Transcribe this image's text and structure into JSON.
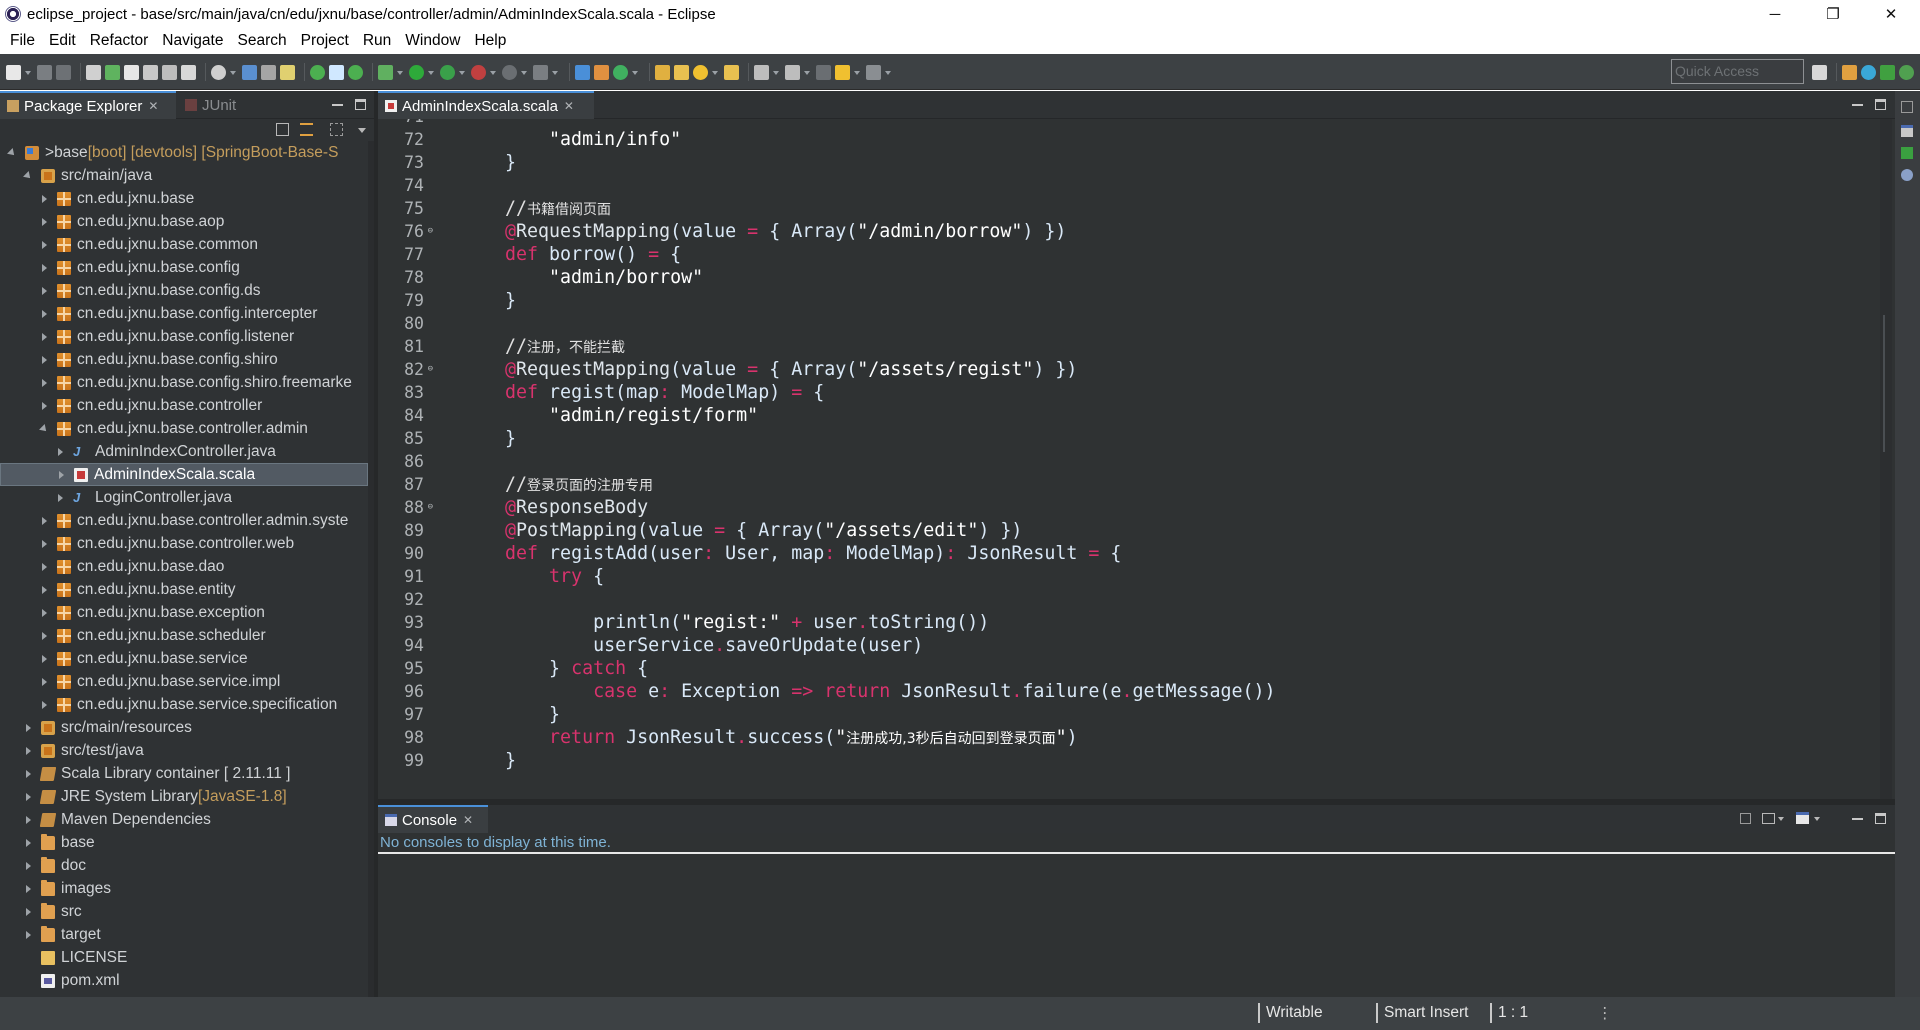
{
  "window": {
    "title": "eclipse_project - base/src/main/java/cn/edu/jxnu/base/controller/admin/AdminIndexScala.scala - Eclipse",
    "minimize": "─",
    "restore": "❐",
    "close": "✕"
  },
  "menu": [
    "File",
    "Edit",
    "Refactor",
    "Navigate",
    "Search",
    "Project",
    "Run",
    "Window",
    "Help"
  ],
  "quick_access": {
    "placeholder": "Quick Access"
  },
  "package_explorer": {
    "tab_label": "Package Explorer",
    "junit_tab_label": "JUnit",
    "tree": [
      {
        "level": 0,
        "twisty": "expanded",
        "icon": "project",
        "prefix": "> ",
        "label": "base",
        "decoration": " [boot] [devtools] [SpringBoot-Base-S"
      },
      {
        "level": 1,
        "twisty": "expanded",
        "icon": "srcfolder",
        "label": "src/main/java"
      },
      {
        "level": 2,
        "twisty": "collapsed",
        "icon": "pkg",
        "label": "cn.edu.jxnu.base"
      },
      {
        "level": 2,
        "twisty": "collapsed",
        "icon": "pkg",
        "label": "cn.edu.jxnu.base.aop"
      },
      {
        "level": 2,
        "twisty": "collapsed",
        "icon": "pkg",
        "label": "cn.edu.jxnu.base.common"
      },
      {
        "level": 2,
        "twisty": "collapsed",
        "icon": "pkg",
        "label": "cn.edu.jxnu.base.config"
      },
      {
        "level": 2,
        "twisty": "collapsed",
        "icon": "pkg",
        "label": "cn.edu.jxnu.base.config.ds"
      },
      {
        "level": 2,
        "twisty": "collapsed",
        "icon": "pkg",
        "label": "cn.edu.jxnu.base.config.intercepter"
      },
      {
        "level": 2,
        "twisty": "collapsed",
        "icon": "pkg",
        "label": "cn.edu.jxnu.base.config.listener"
      },
      {
        "level": 2,
        "twisty": "collapsed",
        "icon": "pkg",
        "label": "cn.edu.jxnu.base.config.shiro"
      },
      {
        "level": 2,
        "twisty": "collapsed",
        "icon": "pkg",
        "label": "cn.edu.jxnu.base.config.shiro.freemarke"
      },
      {
        "level": 2,
        "twisty": "collapsed",
        "icon": "pkg",
        "label": "cn.edu.jxnu.base.controller"
      },
      {
        "level": 2,
        "twisty": "expanded",
        "icon": "pkg",
        "label": "cn.edu.jxnu.base.controller.admin"
      },
      {
        "level": 3,
        "twisty": "collapsed",
        "icon": "java",
        "label": "AdminIndexController.java"
      },
      {
        "level": 3,
        "twisty": "collapsed",
        "icon": "scala",
        "label": "AdminIndexScala.scala",
        "selected": true
      },
      {
        "level": 3,
        "twisty": "collapsed",
        "icon": "java",
        "label": "LoginController.java"
      },
      {
        "level": 2,
        "twisty": "collapsed",
        "icon": "pkg",
        "label": "cn.edu.jxnu.base.controller.admin.syste"
      },
      {
        "level": 2,
        "twisty": "collapsed",
        "icon": "pkg",
        "label": "cn.edu.jxnu.base.controller.web"
      },
      {
        "level": 2,
        "twisty": "collapsed",
        "icon": "pkg",
        "label": "cn.edu.jxnu.base.dao"
      },
      {
        "level": 2,
        "twisty": "collapsed",
        "icon": "pkg",
        "label": "cn.edu.jxnu.base.entity"
      },
      {
        "level": 2,
        "twisty": "collapsed",
        "icon": "pkg",
        "label": "cn.edu.jxnu.base.exception"
      },
      {
        "level": 2,
        "twisty": "collapsed",
        "icon": "pkg",
        "label": "cn.edu.jxnu.base.scheduler"
      },
      {
        "level": 2,
        "twisty": "collapsed",
        "icon": "pkg",
        "label": "cn.edu.jxnu.base.service"
      },
      {
        "level": 2,
        "twisty": "collapsed",
        "icon": "pkg",
        "label": "cn.edu.jxnu.base.service.impl"
      },
      {
        "level": 2,
        "twisty": "collapsed",
        "icon": "pkg",
        "label": "cn.edu.jxnu.base.service.specification"
      },
      {
        "level": 1,
        "twisty": "collapsed",
        "icon": "srcfolder",
        "label": "src/main/resources"
      },
      {
        "level": 1,
        "twisty": "collapsed",
        "icon": "srcfolder",
        "label": "src/test/java"
      },
      {
        "level": 1,
        "twisty": "collapsed",
        "icon": "jar",
        "label": "Scala Library container [ 2.11.11 ]"
      },
      {
        "level": 1,
        "twisty": "collapsed",
        "icon": "jar",
        "label": "JRE System Library",
        "decoration": " [JavaSE-1.8]"
      },
      {
        "level": 1,
        "twisty": "collapsed",
        "icon": "jar",
        "label": "Maven Dependencies"
      },
      {
        "level": 1,
        "twisty": "collapsed",
        "icon": "folder",
        "label": "base"
      },
      {
        "level": 1,
        "twisty": "collapsed",
        "icon": "folder",
        "label": "doc"
      },
      {
        "level": 1,
        "twisty": "collapsed",
        "icon": "folder",
        "label": "images"
      },
      {
        "level": 1,
        "twisty": "collapsed",
        "icon": "folder",
        "label": "src"
      },
      {
        "level": 1,
        "twisty": "collapsed",
        "icon": "folder",
        "label": "target"
      },
      {
        "level": 1,
        "twisty": "none",
        "icon": "file",
        "label": "LICENSE"
      },
      {
        "level": 1,
        "twisty": "none",
        "icon": "xml",
        "label": "pom.xml"
      }
    ]
  },
  "editor": {
    "tab_label": "AdminIndexScala.scala",
    "partial_top_line_number": "71",
    "lines": [
      {
        "n": "72",
        "fold": false,
        "tokens": [
          [
            "str",
            "        \"admin/info\""
          ]
        ]
      },
      {
        "n": "73",
        "fold": false,
        "tokens": [
          [
            "id",
            "    }"
          ]
        ]
      },
      {
        "n": "74",
        "fold": false,
        "tokens": []
      },
      {
        "n": "75",
        "fold": false,
        "tokens": [
          [
            "cmt",
            "    //"
          ],
          [
            "cmtcjk",
            "书籍借阅页面"
          ]
        ]
      },
      {
        "n": "76",
        "fold": true,
        "tokens": [
          [
            "ann",
            "    @"
          ],
          [
            "fn",
            "RequestMapping"
          ],
          [
            "id",
            "(value "
          ],
          [
            "op",
            "="
          ],
          [
            "id",
            " { Array("
          ],
          [
            "str",
            "\"/admin/borrow\""
          ],
          [
            "id",
            ") })"
          ]
        ]
      },
      {
        "n": "77",
        "fold": false,
        "tokens": [
          [
            "kw",
            "    def"
          ],
          [
            "id",
            " borrow() "
          ],
          [
            "op",
            "="
          ],
          [
            "id",
            " {"
          ]
        ]
      },
      {
        "n": "78",
        "fold": false,
        "tokens": [
          [
            "str",
            "        \"admin/borrow\""
          ]
        ]
      },
      {
        "n": "79",
        "fold": false,
        "tokens": [
          [
            "id",
            "    }"
          ]
        ]
      },
      {
        "n": "80",
        "fold": false,
        "tokens": []
      },
      {
        "n": "81",
        "fold": false,
        "tokens": [
          [
            "cmt",
            "    //"
          ],
          [
            "cmtcjk",
            "注册，不能拦截"
          ]
        ]
      },
      {
        "n": "82",
        "fold": true,
        "tokens": [
          [
            "ann",
            "    @"
          ],
          [
            "fn",
            "RequestMapping"
          ],
          [
            "id",
            "(value "
          ],
          [
            "op",
            "="
          ],
          [
            "id",
            " { Array("
          ],
          [
            "str",
            "\"/assets/regist\""
          ],
          [
            "id",
            ") })"
          ]
        ]
      },
      {
        "n": "83",
        "fold": false,
        "tokens": [
          [
            "kw",
            "    def"
          ],
          [
            "id",
            " regist(map"
          ],
          [
            "op",
            ":"
          ],
          [
            "id",
            " ModelMap) "
          ],
          [
            "op",
            "="
          ],
          [
            "id",
            " {"
          ]
        ]
      },
      {
        "n": "84",
        "fold": false,
        "tokens": [
          [
            "str",
            "        \"admin/regist/form\""
          ]
        ]
      },
      {
        "n": "85",
        "fold": false,
        "tokens": [
          [
            "id",
            "    }"
          ]
        ]
      },
      {
        "n": "86",
        "fold": false,
        "tokens": []
      },
      {
        "n": "87",
        "fold": false,
        "tokens": [
          [
            "cmt",
            "    //"
          ],
          [
            "cmtcjk",
            "登录页面的注册专用"
          ]
        ]
      },
      {
        "n": "88",
        "fold": true,
        "tokens": [
          [
            "ann",
            "    @"
          ],
          [
            "fn",
            "ResponseBody"
          ]
        ]
      },
      {
        "n": "89",
        "fold": false,
        "tokens": [
          [
            "ann",
            "    @"
          ],
          [
            "fn",
            "PostMapping"
          ],
          [
            "id",
            "(value "
          ],
          [
            "op",
            "="
          ],
          [
            "id",
            " { Array("
          ],
          [
            "str",
            "\"/assets/edit\""
          ],
          [
            "id",
            ") })"
          ]
        ]
      },
      {
        "n": "90",
        "fold": false,
        "tokens": [
          [
            "kw",
            "    def"
          ],
          [
            "id",
            " registAdd(user"
          ],
          [
            "op",
            ":"
          ],
          [
            "id",
            " User, map"
          ],
          [
            "op",
            ":"
          ],
          [
            "id",
            " ModelMap)"
          ],
          [
            "op",
            ":"
          ],
          [
            "id",
            " JsonResult "
          ],
          [
            "op",
            "="
          ],
          [
            "id",
            " {"
          ]
        ]
      },
      {
        "n": "91",
        "fold": false,
        "tokens": [
          [
            "kw",
            "        try"
          ],
          [
            "id",
            " {"
          ]
        ]
      },
      {
        "n": "92",
        "fold": false,
        "tokens": []
      },
      {
        "n": "93",
        "fold": false,
        "tokens": [
          [
            "id",
            "            println("
          ],
          [
            "str",
            "\"regist:\""
          ],
          [
            "op",
            " +"
          ],
          [
            "id",
            " user"
          ],
          [
            "op",
            "."
          ],
          [
            "id",
            "toString())"
          ]
        ]
      },
      {
        "n": "94",
        "fold": false,
        "tokens": [
          [
            "id",
            "            userService"
          ],
          [
            "op",
            "."
          ],
          [
            "id",
            "saveOrUpdate(user)"
          ]
        ]
      },
      {
        "n": "95",
        "fold": false,
        "tokens": [
          [
            "id",
            "        } "
          ],
          [
            "kw",
            "catch"
          ],
          [
            "id",
            " {"
          ]
        ]
      },
      {
        "n": "96",
        "fold": false,
        "tokens": [
          [
            "kw",
            "            case"
          ],
          [
            "id",
            " e"
          ],
          [
            "op",
            ":"
          ],
          [
            "id",
            " Exception "
          ],
          [
            "op",
            "=>"
          ],
          [
            "kw",
            " return"
          ],
          [
            "id",
            " JsonResult"
          ],
          [
            "op",
            "."
          ],
          [
            "id",
            "failure(e"
          ],
          [
            "op",
            "."
          ],
          [
            "id",
            "getMessage())"
          ]
        ]
      },
      {
        "n": "97",
        "fold": false,
        "tokens": [
          [
            "id",
            "        }"
          ]
        ]
      },
      {
        "n": "98",
        "fold": false,
        "tokens": [
          [
            "kw",
            "        return"
          ],
          [
            "id",
            " JsonResult"
          ],
          [
            "op",
            "."
          ],
          [
            "id",
            "success("
          ],
          [
            "str",
            "\""
          ],
          [
            "strcjk",
            "注册成功,3秒后自动回到登录页面"
          ],
          [
            "str",
            "\""
          ],
          [
            "id",
            ")"
          ]
        ]
      },
      {
        "n": "99",
        "fold": false,
        "tokens": [
          [
            "id",
            "    }"
          ]
        ]
      }
    ]
  },
  "console": {
    "tab_label": "Console",
    "message": "No consoles to display at this time."
  },
  "status": {
    "writable": "Writable",
    "insert_mode": "Smart Insert",
    "position": "1 : 1"
  },
  "colors": {
    "keyword": "#d8336d",
    "string": "#ffffff",
    "identifier": "#d9e8f7",
    "line_number": "#aeb2b5",
    "editor_bg": "#2f3233",
    "console_message": "#7fb3d5",
    "package_decoration": "#c49d5c",
    "selection": "#525a63"
  }
}
